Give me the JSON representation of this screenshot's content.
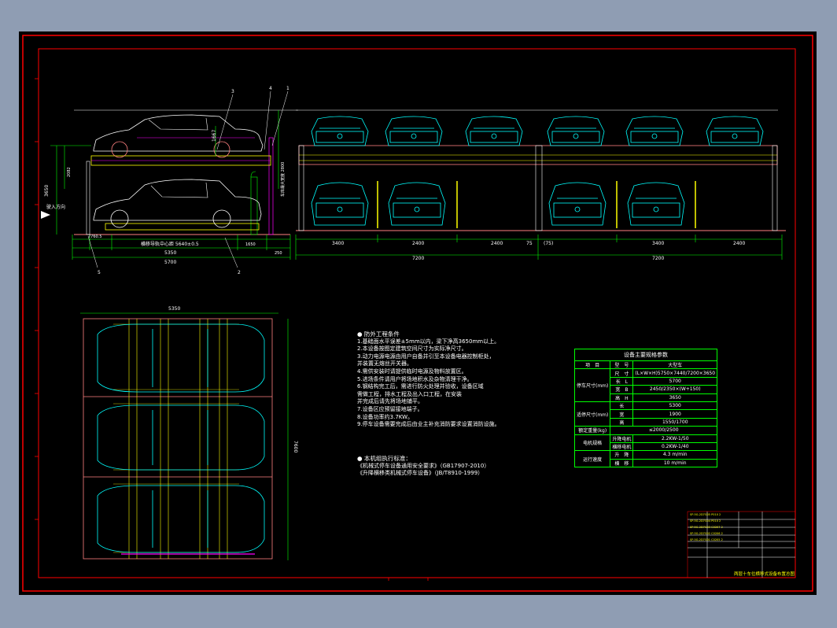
{
  "plan_dims": {
    "side_heights": [
      "3650",
      "1667",
      "2082",
      "1650"
    ],
    "side_bottom": [
      "7760.5",
      "横移导轨中心距 5640±0.5",
      "1650",
      "250"
    ],
    "side_total": [
      "5350",
      "5700"
    ],
    "side_tag": "车库最大宽度 2800",
    "entry": "驶入方向",
    "callouts": [
      "3",
      "4",
      "1",
      "5",
      "2"
    ],
    "front_top": [
      "3400",
      "2400",
      "75",
      "2400",
      "3400",
      "2400"
    ],
    "front_totals": [
      "7200",
      "7200"
    ],
    "front_mid": "(75)",
    "top_width": "5350",
    "top_side": "7600"
  },
  "notes": {
    "heading": "● 防外工程条件",
    "items": [
      "1.基础面水平误差±5mm以内，梁下净高3650mm以上。",
      "2.本设备按图定建筑空间尺寸为实际净尺寸。",
      "3.动力电源电源由用户自备并引至本设备电器控制柜处，",
      "   并装置无熔丝开关器。",
      "4.需供安装时请提供临时电源及物料放置区。",
      "5.进场条件请用户将场地积水及杂物清理干净。",
      "6.钢结构完工后，需进行防火处理并验收，设备区域",
      "   需做工程，排水工程及出入口工程，在安装",
      "   并完成后请先将场地铺平。",
      "7.设备区应预留接地端子。",
      "8.设备功率约3.7KW。",
      "9.停车设备需要完成后由业主补充消防要求设置消防设施。"
    ],
    "std_heading": "● 本机组执行标准：",
    "standards": [
      "《机械式停车设备通用安全要求》（GB17907-2010）",
      "《升降横移类机械式停车设备》（JB/T8910-1999）"
    ]
  },
  "spec": {
    "title": "设备主要规格参数",
    "rows": [
      [
        "项　目",
        "型　号",
        "大型车"
      ],
      [
        "",
        "尺　寸",
        "(L×W×H)5750×7440/7200×3650"
      ],
      [
        "停车尺寸(mm)",
        "长　L",
        "5700"
      ],
      [
        "",
        "宽　B",
        "2450/2350×(W+150)"
      ],
      [
        "",
        "高　H",
        "3650"
      ],
      [
        "适停尺寸(mm)",
        "长",
        "5300"
      ],
      [
        "",
        "宽",
        "1900"
      ],
      [
        "",
        "高",
        "1550/1700"
      ],
      [
        "额定重量(kg)",
        "",
        "≤2000/2500"
      ],
      [
        "电机规格",
        "升降电机",
        "2.2KW-1/50"
      ],
      [
        "",
        "横移电机",
        "0.2KW-1/40"
      ],
      [
        "运行速度",
        "升　降",
        "4.3 m/min"
      ],
      [
        "",
        "横　移",
        "10 m/min"
      ]
    ]
  },
  "title_block": {
    "rows": [
      "SP-5G-2D7G05  P010  2",
      "SP-5G-2D7G04  P010  2",
      "SP-5G-2D7G03  C0207  2",
      "SP-5G-2D7G02  C0206  2",
      "SP-5G-2D7G01  C0205  2"
    ],
    "drawing_name": "两层十车位横移式设备布置总图"
  },
  "colors": {
    "frame": "#ff0000",
    "sheet": "#000000",
    "car": "#00ffff",
    "rail": "#ffff00",
    "beam": "#ff8080",
    "dim": "#00ff00",
    "text": "#ffffff"
  }
}
